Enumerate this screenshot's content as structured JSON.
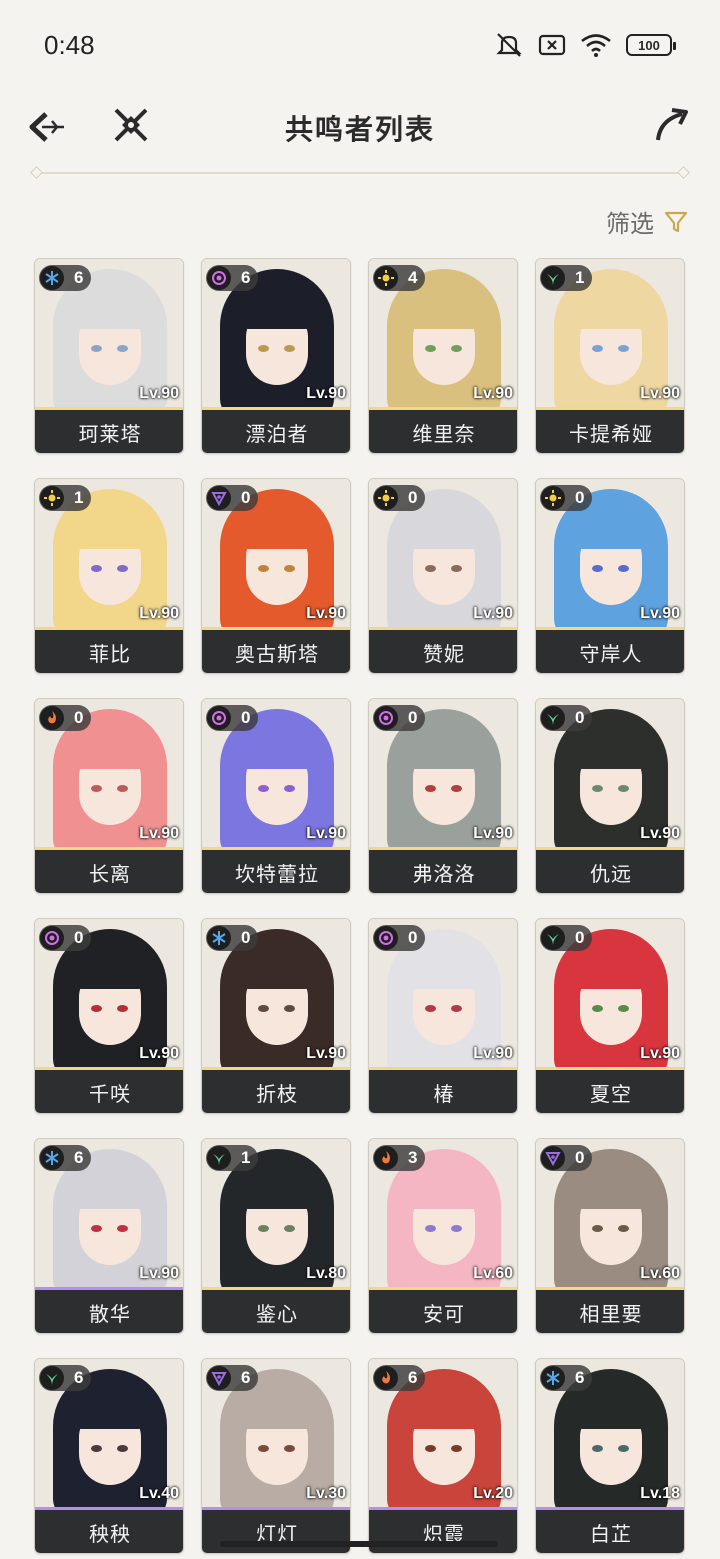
{
  "status_bar": {
    "time": "0:48",
    "battery": "100"
  },
  "header": {
    "title": "共鸣者列表"
  },
  "filter": {
    "label": "筛选"
  },
  "colors": {
    "glacio": "#58a6e8",
    "fusion": "#f07a3c",
    "electro": "#cf6ee6",
    "aero": "#5fd79a",
    "spectro": "#f2cf46",
    "havoc": "#9b6ce0",
    "name_bar": "#2d2e30",
    "accent_gold": "#c9a94a"
  },
  "characters": [
    {
      "name": "珂莱塔",
      "level": "Lv.90",
      "chain": "6",
      "element": "glacio",
      "hair": "#dcdcdc",
      "eye": "#8aa6c6"
    },
    {
      "name": "漂泊者",
      "level": "Lv.90",
      "chain": "6",
      "element": "electro",
      "hair": "#1c1f2a",
      "eye": "#b99a4e"
    },
    {
      "name": "维里奈",
      "level": "Lv.90",
      "chain": "4",
      "element": "spectro",
      "hair": "#d9c07e",
      "eye": "#6fa05a"
    },
    {
      "name": "卡提希娅",
      "level": "Lv.90",
      "chain": "1",
      "element": "aero",
      "hair": "#efd7a2",
      "eye": "#7aa2d8"
    },
    {
      "name": "菲比",
      "level": "Lv.90",
      "chain": "1",
      "element": "spectro",
      "hair": "#f2d68a",
      "eye": "#7e6ac8"
    },
    {
      "name": "奥古斯塔",
      "level": "Lv.90",
      "chain": "0",
      "element": "havoc",
      "hair": "#e45a2c",
      "eye": "#c0833e"
    },
    {
      "name": "赞妮",
      "level": "Lv.90",
      "chain": "0",
      "element": "spectro",
      "hair": "#d8d8dc",
      "eye": "#8a6a5a"
    },
    {
      "name": "守岸人",
      "level": "Lv.90",
      "chain": "0",
      "element": "spectro",
      "hair": "#5ea2e0",
      "eye": "#5a6bd0"
    },
    {
      "name": "长离",
      "level": "Lv.90",
      "chain": "0",
      "element": "fusion",
      "hair": "#f09090",
      "eye": "#c05a5a"
    },
    {
      "name": "坎特蕾拉",
      "level": "Lv.90",
      "chain": "0",
      "element": "electro",
      "hair": "#7c76e0",
      "eye": "#8d5fd0"
    },
    {
      "name": "弗洛洛",
      "level": "Lv.90",
      "chain": "0",
      "element": "electro",
      "hair": "#9aa09c",
      "eye": "#b04040"
    },
    {
      "name": "仇远",
      "level": "Lv.90",
      "chain": "0",
      "element": "aero",
      "hair": "#2c2f2c",
      "eye": "#6a8a70"
    },
    {
      "name": "千咲",
      "level": "Lv.90",
      "chain": "0",
      "element": "electro",
      "hair": "#202124",
      "eye": "#b03038"
    },
    {
      "name": "折枝",
      "level": "Lv.90",
      "chain": "0",
      "element": "glacio",
      "hair": "#3a2b26",
      "eye": "#5e4a40"
    },
    {
      "name": "椿",
      "level": "Lv.90",
      "chain": "0",
      "element": "electro",
      "hair": "#e2e2e6",
      "eye": "#b03a48"
    },
    {
      "name": "夏空",
      "level": "Lv.90",
      "chain": "0",
      "element": "aero",
      "hair": "#d8353f",
      "eye": "#5a8a4a"
    },
    {
      "name": "散华",
      "level": "Lv.90",
      "chain": "6",
      "element": "glacio",
      "hair": "#d2d2d8",
      "eye": "#c03040",
      "purple": true
    },
    {
      "name": "鉴心",
      "level": "Lv.80",
      "chain": "1",
      "element": "aero",
      "hair": "#24272a",
      "eye": "#6a8060"
    },
    {
      "name": "安可",
      "level": "Lv.60",
      "chain": "3",
      "element": "fusion",
      "hair": "#f4b6c2",
      "eye": "#8a7ad0"
    },
    {
      "name": "相里要",
      "level": "Lv.60",
      "chain": "0",
      "element": "havoc",
      "hair": "#9a8c80",
      "eye": "#6a5a4a"
    },
    {
      "name": "秧秧",
      "level": "Lv.40",
      "chain": "6",
      "element": "aero",
      "hair": "#1e2230",
      "eye": "#4a3a40",
      "purple": true
    },
    {
      "name": "灯灯",
      "level": "Lv.30",
      "chain": "6",
      "element": "havoc",
      "hair": "#b8aca4",
      "eye": "#7a4a3a",
      "purple": true
    },
    {
      "name": "炽霞",
      "level": "Lv.20",
      "chain": "6",
      "element": "fusion",
      "hair": "#c9443a",
      "eye": "#7a3a2a",
      "purple": true
    },
    {
      "name": "白芷",
      "level": "Lv.18",
      "chain": "6",
      "element": "glacio",
      "hair": "#252a28",
      "eye": "#4a6a6a",
      "purple": true
    }
  ]
}
